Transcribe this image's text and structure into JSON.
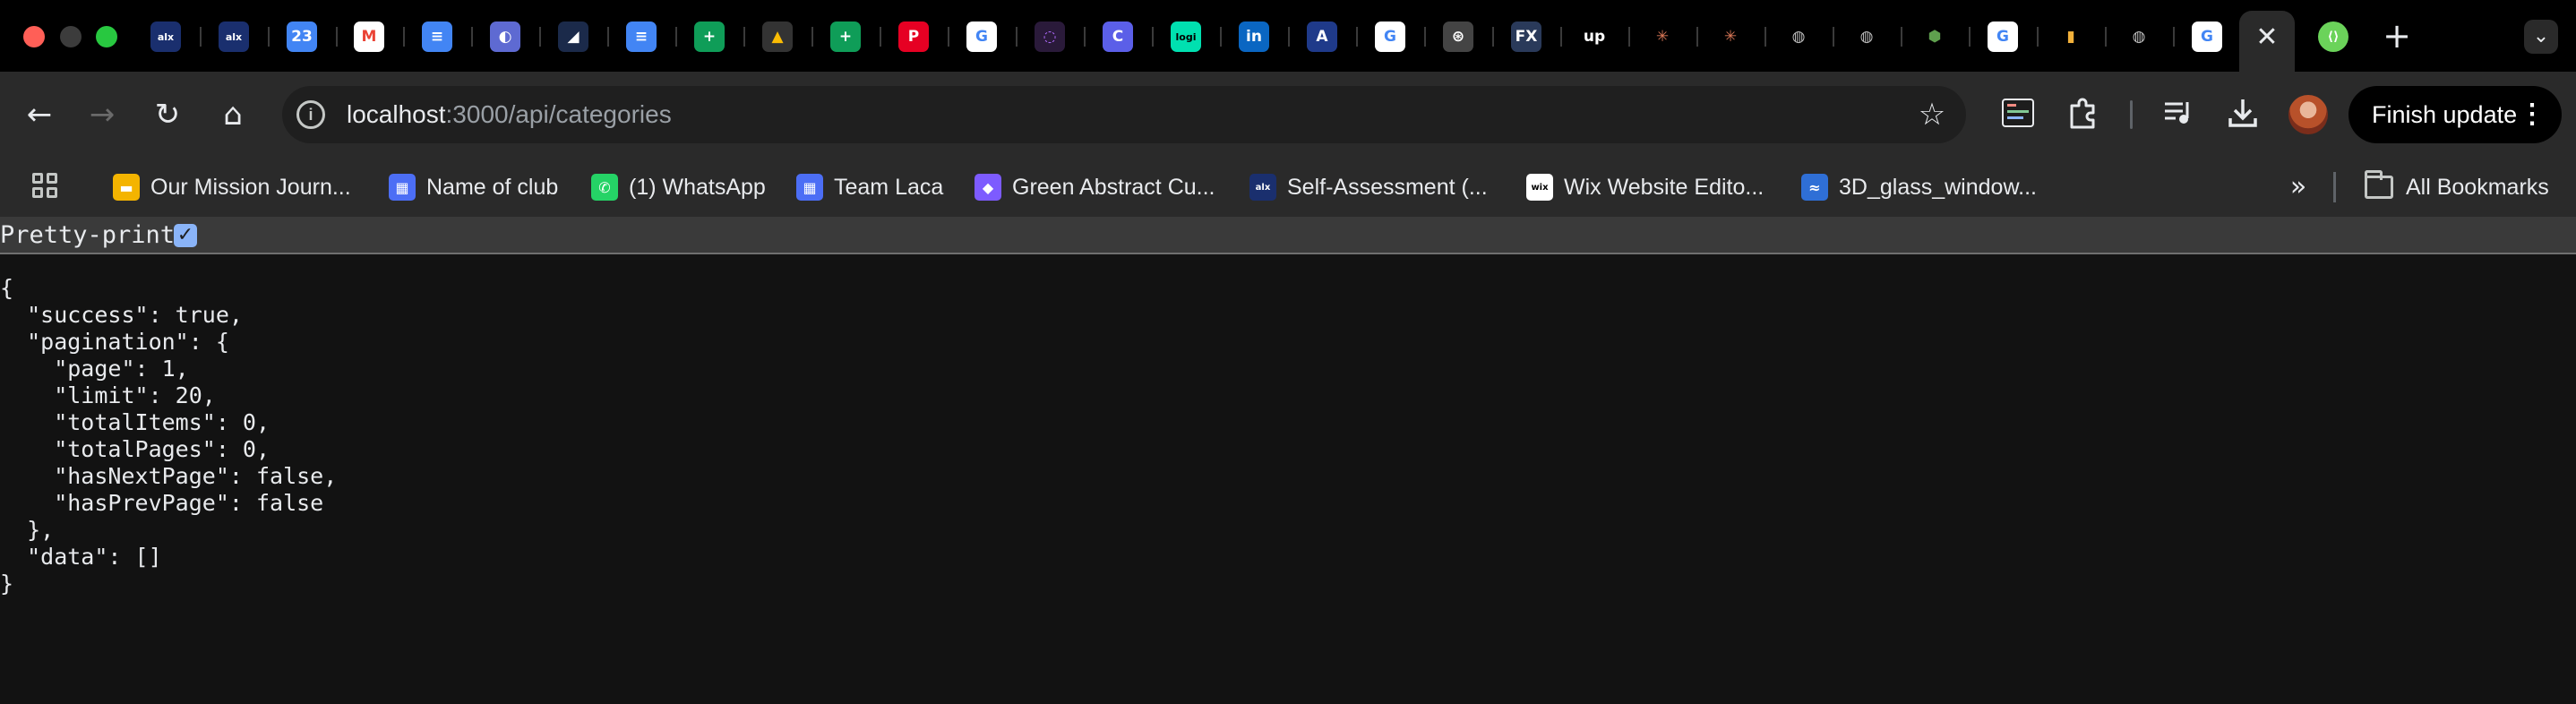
{
  "window": {
    "controls": [
      "close",
      "minimize",
      "zoom"
    ]
  },
  "tabs": {
    "favicons": [
      {
        "name": "alx-icon",
        "glyph": "alx",
        "bg": "#1a2f6e"
      },
      {
        "name": "alx-icon",
        "glyph": "alx",
        "bg": "#1a2f6e"
      },
      {
        "name": "calendar-icon",
        "glyph": "23",
        "bg": "#4285f4"
      },
      {
        "name": "gmail-icon",
        "glyph": "M",
        "bg": "#ffffff",
        "fg": "#ea4335"
      },
      {
        "name": "google-docs-icon",
        "glyph": "≡",
        "bg": "#4285f4"
      },
      {
        "name": "linear-icon",
        "glyph": "◐",
        "bg": "#5e6ad2"
      },
      {
        "name": "dark-brand-icon",
        "glyph": "◢",
        "bg": "#1b2a4a"
      },
      {
        "name": "google-docs-icon",
        "glyph": "≡",
        "bg": "#4285f4"
      },
      {
        "name": "google-sheets-icon",
        "glyph": "+",
        "bg": "#0f9d58"
      },
      {
        "name": "google-drive-icon",
        "glyph": "▲",
        "bg": "#333333",
        "fg": "#fbbc04"
      },
      {
        "name": "google-sheets-icon",
        "glyph": "+",
        "bg": "#0f9d58"
      },
      {
        "name": "pinterest-icon",
        "glyph": "P",
        "bg": "#e60023"
      },
      {
        "name": "google-icon",
        "glyph": "G",
        "bg": "#ffffff",
        "fg": "#4285f4"
      },
      {
        "name": "circle-dots-icon",
        "glyph": "◌",
        "bg": "#2a1a3a",
        "fg": "#b06bff"
      },
      {
        "name": "clockify-icon",
        "glyph": "C",
        "bg": "#5b5fe8"
      },
      {
        "name": "logi-icon",
        "glyph": "logi",
        "bg": "#00e0b0",
        "fg": "#000000"
      },
      {
        "name": "linkedin-icon",
        "glyph": "in",
        "bg": "#0a66c2"
      },
      {
        "name": "arc-icon",
        "glyph": "A",
        "bg": "#1f3a8a"
      },
      {
        "name": "google-icon",
        "glyph": "G",
        "bg": "#ffffff",
        "fg": "#4285f4"
      },
      {
        "name": "openai-icon",
        "glyph": "⊛",
        "bg": "#444444"
      },
      {
        "name": "fx-icon",
        "glyph": "FX",
        "bg": "#2a3a5a"
      },
      {
        "name": "upwork-icon",
        "glyph": "up",
        "bg": "#000000"
      },
      {
        "name": "claude-icon",
        "glyph": "✳",
        "bg": "#000000",
        "fg": "#d97757"
      },
      {
        "name": "claude-icon",
        "glyph": "✳",
        "bg": "#000000",
        "fg": "#d97757"
      },
      {
        "name": "globe-icon",
        "glyph": "◍",
        "bg": "#000000",
        "fg": "#bdbdbd"
      },
      {
        "name": "globe-icon",
        "glyph": "◍",
        "bg": "#000000",
        "fg": "#bdbdbd"
      },
      {
        "name": "nodejs-icon",
        "glyph": "⬢",
        "bg": "#000000",
        "fg": "#5fa04e"
      },
      {
        "name": "google-icon",
        "glyph": "G",
        "bg": "#ffffff",
        "fg": "#4285f4"
      },
      {
        "name": "bottle-icon",
        "glyph": "▮",
        "bg": "#000000",
        "fg": "#f2b13a"
      },
      {
        "name": "globe-icon",
        "glyph": "◍",
        "bg": "#000000",
        "fg": "#bdbdbd"
      },
      {
        "name": "google-icon",
        "glyph": "G",
        "bg": "#ffffff",
        "fg": "#4285f4"
      }
    ],
    "active_close": "✕",
    "after_active": {
      "name": "green-brand-icon",
      "glyph": "⟨⟩",
      "bg": "#6bd35a"
    },
    "new_tab": "+",
    "search": "⌄"
  },
  "toolbar": {
    "back": "←",
    "forward": "→",
    "reload": "↻",
    "home": "⌂",
    "url_host": "localhost",
    "url_path": ":3000/api/categories",
    "bookmark_star": "☆",
    "finish_update": "Finish update",
    "menu": "⋮"
  },
  "bookmarks": {
    "items": [
      {
        "label": "Our Mission Journ...",
        "icon": "notes-icon",
        "glyph": "▬",
        "bg": "#f4b400"
      },
      {
        "label": "Name of club",
        "icon": "forms-icon",
        "glyph": "▦",
        "bg": "#4c6ef5"
      },
      {
        "label": "(1) WhatsApp",
        "icon": "whatsapp-icon",
        "glyph": "✆",
        "bg": "#25d366"
      },
      {
        "label": "Team Laca",
        "icon": "forms-icon",
        "glyph": "▦",
        "bg": "#4c6ef5"
      },
      {
        "label": "Green Abstract Cu...",
        "icon": "canva-icon",
        "glyph": "◆",
        "bg": "#7d5bff"
      },
      {
        "label": "Self-Assessment (...",
        "icon": "alx-icon",
        "glyph": "alx",
        "bg": "#1a2f6e"
      },
      {
        "label": "Wix Website Edito...",
        "icon": "wix-icon",
        "glyph": "wix",
        "bg": "#ffffff",
        "fg": "#000000"
      },
      {
        "label": "3D_glass_window...",
        "icon": "tailwind-icon",
        "glyph": "≈",
        "bg": "#2f6fd6"
      }
    ],
    "more": "»",
    "all_bookmarks": "All Bookmarks"
  },
  "page": {
    "pretty_print_label": "Pretty-print",
    "pretty_print_checked": true,
    "json_text": "{\n  \"success\": true,\n  \"pagination\": {\n    \"page\": 1,\n    \"limit\": 20,\n    \"totalItems\": 0,\n    \"totalPages\": 0,\n    \"hasNextPage\": false,\n    \"hasPrevPage\": false\n  },\n  \"data\": []\n}"
  }
}
